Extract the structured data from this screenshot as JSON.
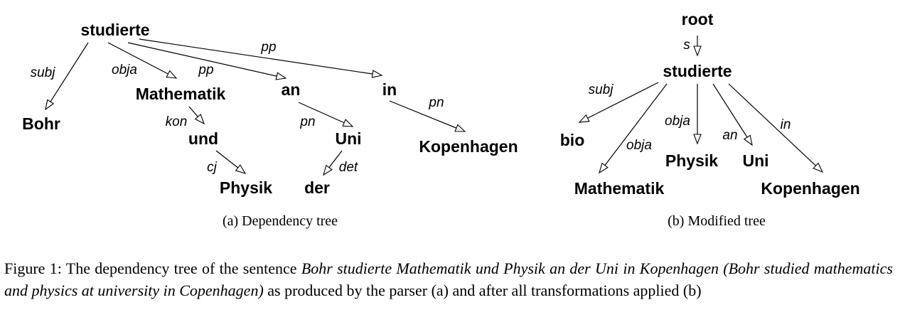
{
  "tree_a": {
    "caption": "(a)  Dependency tree",
    "nodes": [
      {
        "id": "studierte",
        "label": "studierte"
      },
      {
        "id": "Bohr",
        "label": "Bohr"
      },
      {
        "id": "Mathematik",
        "label": "Mathematik"
      },
      {
        "id": "an",
        "label": "an"
      },
      {
        "id": "in",
        "label": "in"
      },
      {
        "id": "und",
        "label": "und"
      },
      {
        "id": "Uni",
        "label": "Uni"
      },
      {
        "id": "Kopenhagen",
        "label": "Kopenhagen"
      },
      {
        "id": "Physik",
        "label": "Physik"
      },
      {
        "id": "der",
        "label": "der"
      }
    ],
    "edges": [
      {
        "from": "studierte",
        "to": "Bohr",
        "label": "subj"
      },
      {
        "from": "studierte",
        "to": "Mathematik",
        "label": "obja"
      },
      {
        "from": "studierte",
        "to": "an",
        "label": "pp"
      },
      {
        "from": "studierte",
        "to": "in",
        "label": "pp"
      },
      {
        "from": "Mathematik",
        "to": "und",
        "label": "kon"
      },
      {
        "from": "und",
        "to": "Physik",
        "label": "cj"
      },
      {
        "from": "an",
        "to": "Uni",
        "label": "pn"
      },
      {
        "from": "Uni",
        "to": "der",
        "label": "det"
      },
      {
        "from": "in",
        "to": "Kopenhagen",
        "label": "pn"
      }
    ]
  },
  "tree_b": {
    "caption": "(b)  Modified tree",
    "nodes": [
      {
        "id": "root",
        "label": "root"
      },
      {
        "id": "studierte",
        "label": "studierte"
      },
      {
        "id": "bio",
        "label": "bio"
      },
      {
        "id": "Mathematik",
        "label": "Mathematik"
      },
      {
        "id": "Physik",
        "label": "Physik"
      },
      {
        "id": "Uni",
        "label": "Uni"
      },
      {
        "id": "Kopenhagen",
        "label": "Kopenhagen"
      }
    ],
    "edges": [
      {
        "from": "root",
        "to": "studierte",
        "label": "s"
      },
      {
        "from": "studierte",
        "to": "bio",
        "label": "subj"
      },
      {
        "from": "studierte",
        "to": "Mathematik",
        "label": "obja"
      },
      {
        "from": "studierte",
        "to": "Physik",
        "label": "obja"
      },
      {
        "from": "studierte",
        "to": "Uni",
        "label": "an"
      },
      {
        "from": "studierte",
        "to": "Kopenhagen",
        "label": "in"
      }
    ]
  },
  "caption": {
    "prefix": "Figure 1:  The dependency tree of the sentence ",
    "sentence": "Bohr studierte Mathematik und Physik an der Uni in Kopenhagen (Bohr studied mathematics and physics at university in Copenhagen)",
    "suffix": " as produced by the parser (a) and after all transformations applied (b)"
  }
}
